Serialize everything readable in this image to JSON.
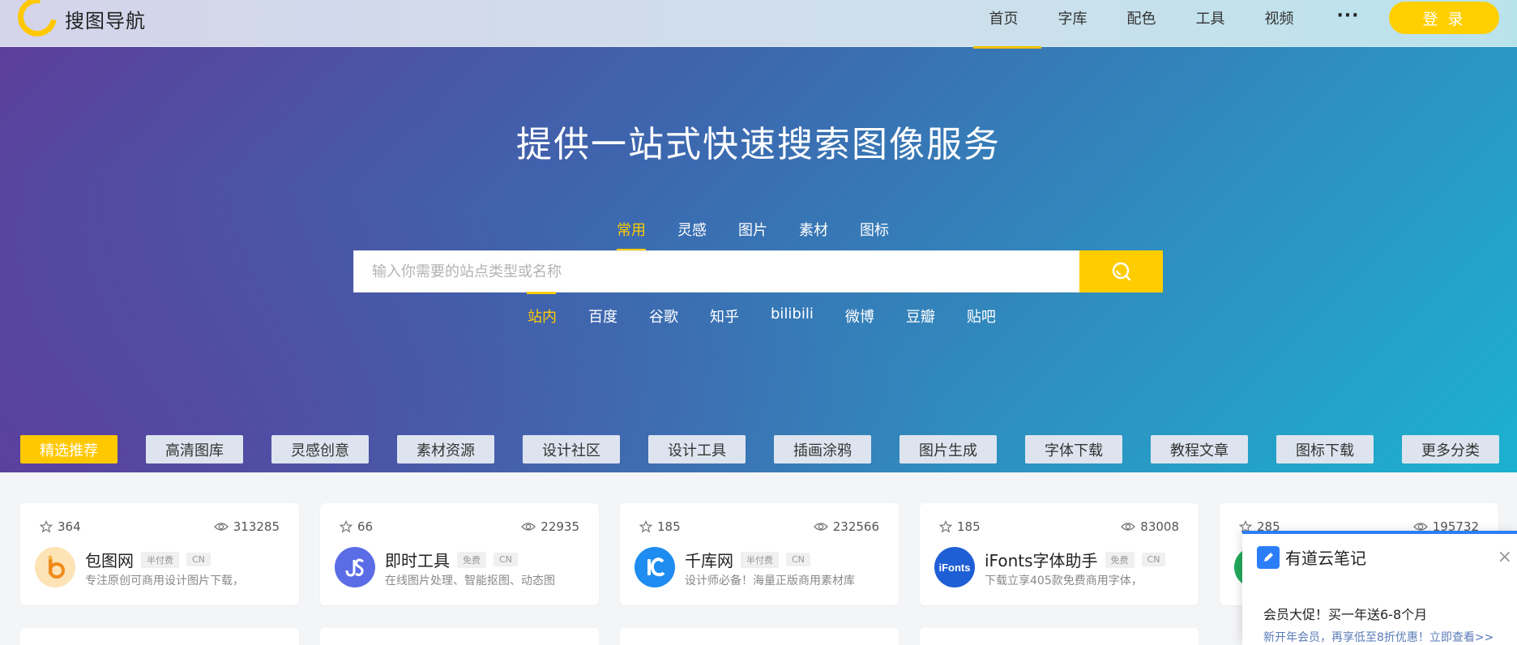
{
  "site": {
    "logo_text": "搜图导航"
  },
  "nav": {
    "items": [
      "首页",
      "字库",
      "配色",
      "工具",
      "视频"
    ],
    "more": "···",
    "login": "登 录"
  },
  "hero": {
    "title": "提供一站式快速搜索图像服务",
    "tabs": [
      "常用",
      "灵感",
      "图片",
      "素材",
      "图标"
    ],
    "active_tab": "常用",
    "search_placeholder": "输入你需要的站点类型或名称",
    "engines": [
      "站内",
      "百度",
      "谷歌",
      "知乎",
      "bilibili",
      "微博",
      "豆瓣",
      "贴吧"
    ],
    "active_engine": "站内"
  },
  "categories": [
    "精选推荐",
    "高清图库",
    "灵感创意",
    "素材资源",
    "设计社区",
    "设计工具",
    "插画涂鸦",
    "图片生成",
    "字体下载",
    "教程文章",
    "图标下载",
    "更多分类"
  ],
  "cards": [
    {
      "stars": "364",
      "views": "313285",
      "name": "包图网",
      "tag1": "半付费",
      "tag2": "CN",
      "desc": "专注原创可商用设计图片下载，",
      "logo_color": "#f5a623",
      "logo_text": "b"
    },
    {
      "stars": "66",
      "views": "22935",
      "name": "即时工具",
      "tag1": "免费",
      "tag2": "CN",
      "desc": "在线图片处理、智能抠图、动态图",
      "logo_color": "#5b6de6",
      "logo_text": "JS"
    },
    {
      "stars": "185",
      "views": "232566",
      "name": "千库网",
      "tag1": "半付费",
      "tag2": "CN",
      "desc": "设计师必备！海量正版商用素材库",
      "logo_color": "#1e8cf0",
      "logo_text": "IC"
    },
    {
      "stars": "185",
      "views": "83008",
      "name": "iFonts字体助手",
      "tag1": "免费",
      "tag2": "CN",
      "desc": "下载立享405款免费商用字体，",
      "logo_color": "#1f5fd6",
      "logo_text": "iFonts"
    },
    {
      "stars": "285",
      "views": "195732",
      "name": "",
      "tag1": "",
      "tag2": "",
      "desc": "",
      "logo_color": "#22a85a",
      "logo_text": ""
    }
  ],
  "popup": {
    "title": "有道云笔记",
    "close": "×",
    "main": "会员大促！买一年送6-8个月",
    "sub": "新开年会员，再享低至8折优惠！立即查看>>"
  },
  "colors": {
    "accent": "#ffcc00",
    "popup_blue": "#2b7ef7"
  }
}
